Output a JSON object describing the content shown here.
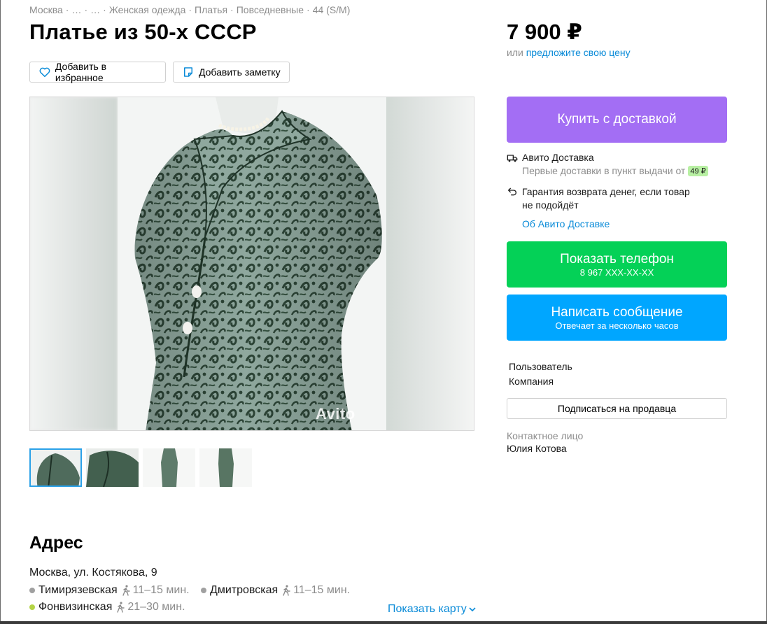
{
  "breadcrumb": [
    "Москва",
    "…",
    "…",
    "Женская одежда",
    "Платья",
    "Повседневные",
    "44 (S/M)"
  ],
  "listing": {
    "title": "Платье из 50-х СССР",
    "price": "7 900 ₽",
    "offer_prefix": "или",
    "offer_link": "предложите свою цену"
  },
  "actions": {
    "favorite": "Добавить в избранное",
    "note": "Добавить заметку"
  },
  "gallery": {
    "watermark": "Avito",
    "thumb_count": 4,
    "active_thumb": 0
  },
  "buy": {
    "label": "Купить с доставкой"
  },
  "delivery": {
    "title": "Авито Доставка",
    "subtitle": "Первые доставки в пункт выдачи от",
    "badge": "49 ₽",
    "guarantee_line1": "Гарантия возврата денег, если товар",
    "guarantee_line2": "не подойдёт",
    "about_link": "Об Авито Доставке"
  },
  "phone": {
    "label": "Показать телефон",
    "number": "8 967 XXX-XX-XX"
  },
  "message": {
    "label": "Написать сообщение",
    "note": "Отвечает за несколько часов"
  },
  "seller": {
    "line1": "Пользователь",
    "line2": "Компания",
    "subscribe": "Подписаться на продавца",
    "contact_label": "Контактное лицо",
    "contact_name": "Юлия Котова"
  },
  "address": {
    "heading": "Адрес",
    "street": "Москва, ул. Костякова, 9",
    "metro": [
      {
        "name": "Тимирязевская",
        "time": "11–15 мин.",
        "color": "#a0a0a0"
      },
      {
        "name": "Дмитровская",
        "time": "11–15 мин.",
        "color": "#a0a0a0"
      },
      {
        "name": "Фонвизинская",
        "time": "21–30 мин.",
        "color": "#b4d445"
      }
    ],
    "show_map": "Показать карту"
  },
  "colors": {
    "buy": "#a36ef4",
    "phone": "#04d157",
    "message": "#00a6ff",
    "link": "#0a8bd8"
  }
}
